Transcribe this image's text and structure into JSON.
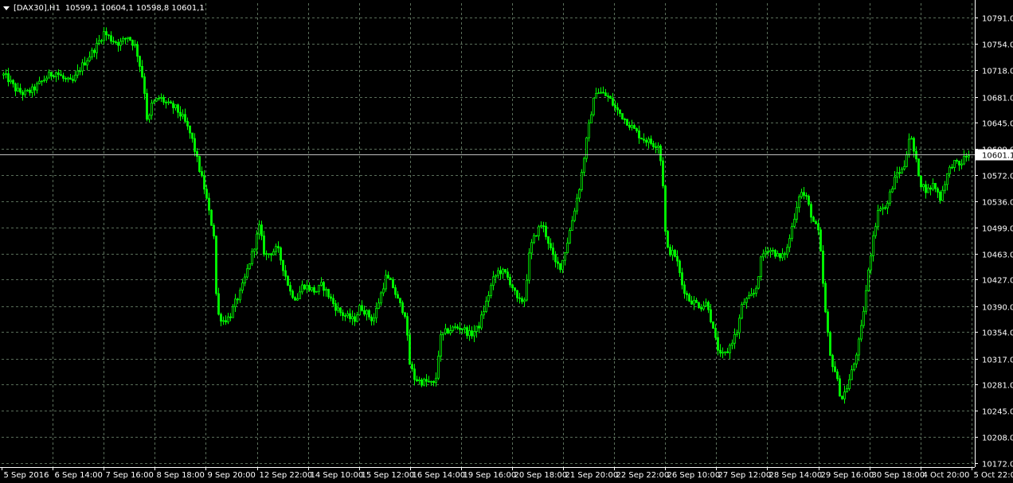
{
  "header": {
    "symbol_timeframe": "[DAX30],H1",
    "ohlc": "10599,1 10604,1 10598,8 10601,1"
  },
  "colors": {
    "background": "#000000",
    "candle": "#00ff00",
    "grid": "#5a6e5a",
    "axis": "#ffffff",
    "price_line": "#c0c0c0"
  },
  "current_price": {
    "value": 10601.1,
    "label": "10601.1"
  },
  "chart_data": {
    "type": "candlestick",
    "title": "[DAX30],H1",
    "grid": true,
    "ylim": [
      10172.0,
      10791.0
    ],
    "y_ticks": [
      "10791.0",
      "10754.0",
      "10718.0",
      "10681.0",
      "10645.0",
      "10609.0",
      "10572.0",
      "10536.0",
      "10499.0",
      "10463.0",
      "10427.0",
      "10390.0",
      "10354.0",
      "10317.0",
      "10281.0",
      "10245.0",
      "10208.0",
      "10172.0"
    ],
    "x_ticks": [
      "5 Sep 2016",
      "6 Sep 14:00",
      "7 Sep 16:00",
      "8 Sep 18:00",
      "9 Sep 20:00",
      "12 Sep 22:00",
      "14 Sep 10:00",
      "15 Sep 12:00",
      "16 Sep 14:00",
      "19 Sep 16:00",
      "20 Sep 18:00",
      "21 Sep 20:00",
      "22 Sep 22:00",
      "26 Sep 10:00",
      "27 Sep 12:00",
      "28 Sep 14:00",
      "29 Sep 16:00",
      "30 Sep 18:00",
      "4 Oct 20:00",
      "5 Oct 22:00"
    ],
    "series": [
      {
        "close_path": [
          [
            0,
            10715
          ],
          [
            10,
            10705
          ],
          [
            20,
            10690
          ],
          [
            30,
            10685
          ],
          [
            40,
            10690
          ],
          [
            50,
            10700
          ],
          [
            60,
            10710
          ],
          [
            70,
            10715
          ],
          [
            80,
            10705
          ],
          [
            90,
            10700
          ],
          [
            100,
            10720
          ],
          [
            110,
            10735
          ],
          [
            120,
            10750
          ],
          [
            130,
            10770
          ],
          [
            140,
            10760
          ],
          [
            150,
            10755
          ],
          [
            160,
            10765
          ],
          [
            170,
            10750
          ],
          [
            180,
            10700
          ],
          [
            185,
            10640
          ],
          [
            190,
            10670
          ],
          [
            200,
            10680
          ],
          [
            210,
            10670
          ],
          [
            220,
            10665
          ],
          [
            230,
            10650
          ],
          [
            240,
            10625
          ],
          [
            250,
            10580
          ],
          [
            257,
            10550
          ],
          [
            262,
            10520
          ],
          [
            268,
            10490
          ],
          [
            272,
            10380
          ],
          [
            280,
            10370
          ],
          [
            288,
            10375
          ],
          [
            295,
            10395
          ],
          [
            302,
            10410
          ],
          [
            310,
            10440
          ],
          [
            318,
            10470
          ],
          [
            325,
            10500
          ],
          [
            332,
            10460
          ],
          [
            340,
            10465
          ],
          [
            348,
            10470
          ],
          [
            356,
            10440
          ],
          [
            364,
            10410
          ],
          [
            372,
            10400
          ],
          [
            380,
            10420
          ],
          [
            388,
            10415
          ],
          [
            396,
            10410
          ],
          [
            404,
            10420
          ],
          [
            412,
            10405
          ],
          [
            420,
            10390
          ],
          [
            428,
            10380
          ],
          [
            436,
            10375
          ],
          [
            444,
            10370
          ],
          [
            452,
            10390
          ],
          [
            460,
            10380
          ],
          [
            468,
            10370
          ],
          [
            476,
            10400
          ],
          [
            484,
            10430
          ],
          [
            492,
            10420
          ],
          [
            500,
            10395
          ],
          [
            508,
            10380
          ],
          [
            514,
            10310
          ],
          [
            520,
            10290
          ],
          [
            528,
            10285
          ],
          [
            536,
            10285
          ],
          [
            546,
            10280
          ],
          [
            552,
            10345
          ],
          [
            560,
            10355
          ],
          [
            570,
            10360
          ],
          [
            580,
            10360
          ],
          [
            590,
            10350
          ],
          [
            600,
            10360
          ],
          [
            610,
            10395
          ],
          [
            618,
            10425
          ],
          [
            626,
            10440
          ],
          [
            634,
            10435
          ],
          [
            642,
            10420
          ],
          [
            650,
            10395
          ],
          [
            658,
            10400
          ],
          [
            665,
            10470
          ],
          [
            672,
            10490
          ],
          [
            680,
            10505
          ],
          [
            688,
            10480
          ],
          [
            696,
            10450
          ],
          [
            704,
            10445
          ],
          [
            712,
            10480
          ],
          [
            720,
            10520
          ],
          [
            728,
            10560
          ],
          [
            736,
            10620
          ],
          [
            742,
            10660
          ],
          [
            748,
            10690
          ],
          [
            756,
            10685
          ],
          [
            764,
            10680
          ],
          [
            772,
            10665
          ],
          [
            780,
            10655
          ],
          [
            788,
            10645
          ],
          [
            796,
            10635
          ],
          [
            804,
            10625
          ],
          [
            812,
            10620
          ],
          [
            820,
            10615
          ],
          [
            827,
            10615
          ],
          [
            832,
            10560
          ],
          [
            836,
            10470
          ],
          [
            842,
            10465
          ],
          [
            848,
            10460
          ],
          [
            856,
            10420
          ],
          [
            864,
            10400
          ],
          [
            872,
            10395
          ],
          [
            880,
            10390
          ],
          [
            888,
            10395
          ],
          [
            896,
            10350
          ],
          [
            904,
            10320
          ],
          [
            912,
            10325
          ],
          [
            918,
            10340
          ],
          [
            925,
            10355
          ],
          [
            932,
            10395
          ],
          [
            940,
            10400
          ],
          [
            948,
            10410
          ],
          [
            956,
            10460
          ],
          [
            964,
            10470
          ],
          [
            972,
            10465
          ],
          [
            980,
            10455
          ],
          [
            988,
            10470
          ],
          [
            996,
            10510
          ],
          [
            1004,
            10550
          ],
          [
            1012,
            10540
          ],
          [
            1020,
            10510
          ],
          [
            1028,
            10490
          ],
          [
            1036,
            10380
          ],
          [
            1042,
            10320
          ],
          [
            1048,
            10300
          ],
          [
            1056,
            10260
          ],
          [
            1064,
            10280
          ],
          [
            1072,
            10310
          ],
          [
            1080,
            10350
          ],
          [
            1088,
            10420
          ],
          [
            1096,
            10490
          ],
          [
            1104,
            10530
          ],
          [
            1112,
            10525
          ],
          [
            1118,
            10550
          ],
          [
            1126,
            10575
          ],
          [
            1134,
            10580
          ],
          [
            1142,
            10630
          ],
          [
            1148,
            10600
          ],
          [
            1156,
            10560
          ],
          [
            1164,
            10550
          ],
          [
            1172,
            10560
          ],
          [
            1180,
            10540
          ],
          [
            1188,
            10570
          ],
          [
            1196,
            10590
          ],
          [
            1204,
            10585
          ],
          [
            1210,
            10595
          ],
          [
            1216,
            10601.1
          ]
        ]
      }
    ]
  }
}
